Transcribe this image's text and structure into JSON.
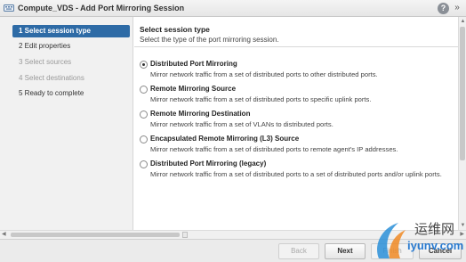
{
  "window": {
    "title": "Compute_VDS - Add Port Mirroring Session",
    "help_label": "?",
    "expand_label": "»"
  },
  "sidebar": {
    "steps": [
      {
        "label": "1  Select session type",
        "state": "active"
      },
      {
        "label": "2  Edit properties",
        "state": "enabled"
      },
      {
        "label": "3  Select sources",
        "state": "disabled"
      },
      {
        "label": "4  Select destinations",
        "state": "disabled"
      },
      {
        "label": "5  Ready to complete",
        "state": "enabled"
      }
    ]
  },
  "main": {
    "title": "Select session type",
    "subtitle": "Select the type of the port mirroring session.",
    "options": [
      {
        "label": "Distributed Port Mirroring",
        "description": "Mirror network traffic from a set of distributed ports to other distributed ports.",
        "checked": true
      },
      {
        "label": "Remote Mirroring Source",
        "description": "Mirror network traffic from a set of distributed ports to specific uplink ports.",
        "checked": false
      },
      {
        "label": "Remote Mirroring Destination",
        "description": "Mirror network traffic from a set of VLANs to distributed ports.",
        "checked": false
      },
      {
        "label": "Encapsulated Remote Mirroring (L3) Source",
        "description": "Mirror network traffic from a set of distributed ports to remote agent's IP addresses.",
        "checked": false
      },
      {
        "label": "Distributed Port Mirroring (legacy)",
        "description": "Mirror network traffic from a set of distributed ports to a set of distributed ports and/or uplink ports.",
        "checked": false
      }
    ]
  },
  "footer": {
    "back_label": "Back",
    "next_label": "Next",
    "finish_label": "Finish",
    "cancel_label": "Cancel"
  },
  "watermark": {
    "line1": "运维网",
    "line2": "iyunv.com"
  },
  "colors": {
    "accent": "#2e6ba6",
    "sidebar_bg": "#f1f1f1",
    "footer_bg": "#ebebeb"
  }
}
